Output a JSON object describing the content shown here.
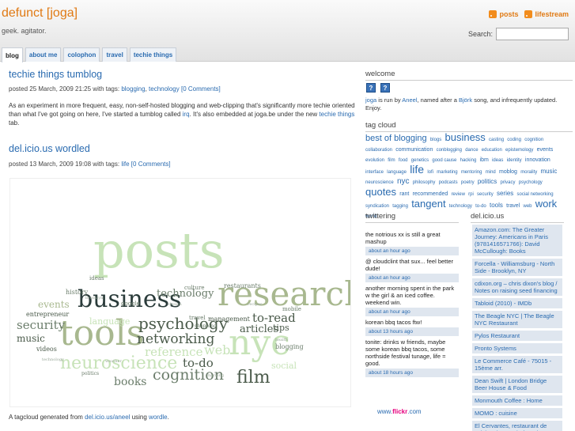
{
  "header": {
    "site_title": "defunct [joga]",
    "tagline": "geek. agitator.",
    "posts_link": "posts",
    "lifestream_link": "lifestream",
    "search_label": "Search:",
    "search_value": ""
  },
  "tabs": [
    "blog",
    "about me",
    "colophon",
    "travel",
    "techie things"
  ],
  "posts": [
    {
      "title": "techie things tumblog",
      "meta_prefix": "posted 25 March, 2009 21:25 with tags:",
      "tags": [
        "blogging",
        "technology"
      ],
      "comments": "[0 Comments]",
      "body_a": "As an experiment in more frequent, easy, non-self-hosted blogging and web-clipping that's significantly more techie oriented than what I've got going on here, I've started a tumblog called",
      "body_link1": "irq",
      "body_b": ". It's also embedded at joga.be under the new",
      "body_link2": "techie things",
      "body_c": "tab."
    },
    {
      "title": "del.icio.us wordled",
      "meta_prefix": "posted 13 March, 2009 19:08 with tags:",
      "tags": [
        "life"
      ],
      "comments": "[0 Comments]"
    }
  ],
  "wordle_words": [
    "posts",
    "research",
    "business",
    "tools",
    "psychology",
    "networking",
    "nyc",
    "neuroscience",
    "cognition",
    "film",
    "reference",
    "to-do",
    "books",
    "events",
    "security",
    "music",
    "language",
    "technology",
    "articles",
    "tips",
    "restaurants",
    "to-read",
    "web",
    "social",
    "history",
    "entrepreneur",
    "videos",
    "management",
    "ideas",
    "google",
    "culture",
    "travel",
    "politics",
    "shopping",
    "blogging",
    "mobile"
  ],
  "cloud_caption": {
    "prefix": "A tagcloud generated from",
    "link1": "del.icio.us/aneel",
    "middle": "using",
    "link2": "wordle",
    "suffix": "."
  },
  "sidebar": {
    "welcome_heading": "welcome",
    "welcome": {
      "w1": "joga",
      "t1": " is run by ",
      "w2": "Aneel",
      "t2": ", named after a ",
      "w3": "Björk",
      "t3": " song, and infrequently updated. Enjoy."
    },
    "tagcloud_heading": "tag cloud",
    "tags": [
      {
        "t": "best of blogging",
        "s": 11
      },
      {
        "t": "blogs",
        "s": 6
      },
      {
        "t": "business",
        "s": 13
      },
      {
        "t": "casting",
        "s": 6
      },
      {
        "t": "coding",
        "s": 6
      },
      {
        "t": "cognition",
        "s": 6
      },
      {
        "t": "collaboration",
        "s": 6
      },
      {
        "t": "communication",
        "s": 7
      },
      {
        "t": "conblogging",
        "s": 6
      },
      {
        "t": "dance",
        "s": 6
      },
      {
        "t": "education",
        "s": 6
      },
      {
        "t": "epistemology",
        "s": 6
      },
      {
        "t": "events",
        "s": 7
      },
      {
        "t": "evolution",
        "s": 6
      },
      {
        "t": "film",
        "s": 6
      },
      {
        "t": "food",
        "s": 6
      },
      {
        "t": "genetics",
        "s": 6
      },
      {
        "t": "good cause",
        "s": 6
      },
      {
        "t": "hacking",
        "s": 6
      },
      {
        "t": "ibm",
        "s": 7
      },
      {
        "t": "ideas",
        "s": 6
      },
      {
        "t": "identity",
        "s": 6
      },
      {
        "t": "innovation",
        "s": 7
      },
      {
        "t": "interface",
        "s": 6
      },
      {
        "t": "language",
        "s": 6
      },
      {
        "t": "life",
        "s": 14
      },
      {
        "t": "lofi",
        "s": 6
      },
      {
        "t": "marketing",
        "s": 6
      },
      {
        "t": "mentoring",
        "s": 6
      },
      {
        "t": "mind",
        "s": 6
      },
      {
        "t": "moblog",
        "s": 7
      },
      {
        "t": "morality",
        "s": 6
      },
      {
        "t": "music",
        "s": 8
      },
      {
        "t": "neuroscience",
        "s": 6
      },
      {
        "t": "nyc",
        "s": 10
      },
      {
        "t": "philosophy",
        "s": 6
      },
      {
        "t": "podcasts",
        "s": 6
      },
      {
        "t": "poetry",
        "s": 6
      },
      {
        "t": "politics",
        "s": 8
      },
      {
        "t": "privacy",
        "s": 6
      },
      {
        "t": "psychology",
        "s": 6
      },
      {
        "t": "quotes",
        "s": 13
      },
      {
        "t": "rant",
        "s": 7
      },
      {
        "t": "recommended",
        "s": 7
      },
      {
        "t": "review",
        "s": 6
      },
      {
        "t": "rpi",
        "s": 6
      },
      {
        "t": "security",
        "s": 6
      },
      {
        "t": "series",
        "s": 8
      },
      {
        "t": "social networking",
        "s": 6
      },
      {
        "t": "syndication",
        "s": 6
      },
      {
        "t": "tagging",
        "s": 6
      },
      {
        "t": "tangent",
        "s": 13
      },
      {
        "t": "technology",
        "s": 6
      },
      {
        "t": "to-do",
        "s": 6
      },
      {
        "t": "tools",
        "s": 8
      },
      {
        "t": "travel",
        "s": 7
      },
      {
        "t": "web",
        "s": 6
      },
      {
        "t": "work",
        "s": 13
      },
      {
        "t": "world",
        "s": 6
      }
    ],
    "twittering_heading": "twittering",
    "tweets": [
      {
        "text": "the notrious xx is still a great mashup",
        "time": "about an hour ago"
      },
      {
        "text": "@ cloudclint that sux... feel better dude!",
        "time": "about an hour ago"
      },
      {
        "text": "another morning spent in the park w the girl & an iced coffee. weekend win.",
        "time": "about an hour ago"
      },
      {
        "text": "korean bbq tacos ftw!",
        "time": "about 13 hours ago"
      },
      {
        "text": "tonite: drinks w friends, maybe some korean bbq tacos, some northside festival tunage, life = good.",
        "time": "about 18 hours ago"
      }
    ],
    "flickr_prefix": "www.",
    "flickr_brand": "flickr",
    "flickr_suffix": ".com",
    "delicious_heading": "del.icio.us",
    "delicious": [
      "Amazon.com: The Greater Journey: Americans in Paris (9781416571766): David McCullough: Books",
      "Forcella - Williamsburg - North Side - Brooklyn, NY",
      "cdixon.org – chris dixon's blog / Notes on raising seed financing",
      "Tabloid (2010) - IMDb",
      "The Beagle NYC | The Beagle NYC Restaurant",
      "Pylos Restaurant",
      "Pronto Systems",
      "Le Commerce Café - 75015 - 15ème arr.",
      "Dean Swift | London Bridge Beer House & Food",
      "Monmouth Coffee : Home",
      "MOMO : cuisine",
      "El Cervantes, restaurant de cuisine du monde à Paris."
    ]
  },
  "colors": {
    "accent": "#e07a14",
    "link": "#2a6bb0",
    "sidebar_item_bg": "#dfe6ef"
  }
}
